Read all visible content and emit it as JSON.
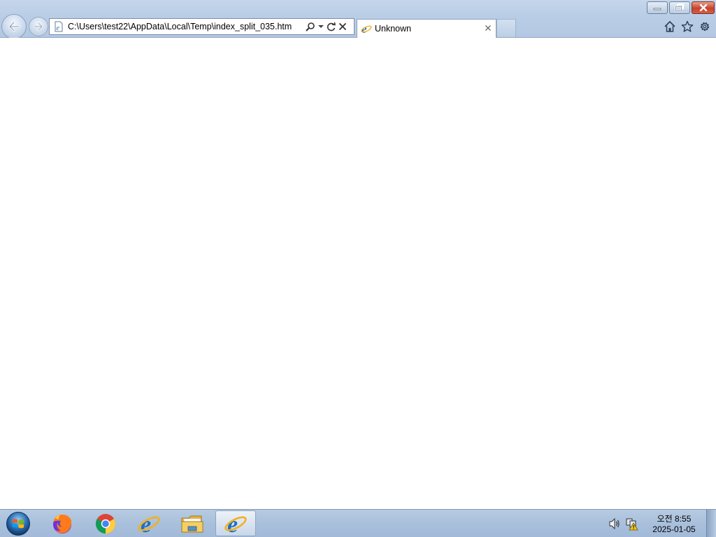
{
  "browser": {
    "address_bar": {
      "url": "C:\\Users\\test22\\AppData\\Local\\Temp\\index_split_035.htm"
    },
    "tabs": [
      {
        "title": "Unknown",
        "active": true
      }
    ],
    "icons": {
      "back": "back-arrow-icon",
      "forward": "forward-arrow-icon",
      "page": "ie-page-icon",
      "search": "search-icon",
      "dropdown": "chevron-down-icon",
      "refresh": "refresh-icon",
      "stop": "stop-icon",
      "home": "home-icon",
      "favorites": "star-icon",
      "tools": "gear-icon"
    }
  },
  "taskbar": {
    "apps": [
      {
        "name": "Firefox",
        "icon": "firefox-icon"
      },
      {
        "name": "Chrome",
        "icon": "chrome-icon"
      },
      {
        "name": "Internet Explorer",
        "icon": "ie-icon"
      },
      {
        "name": "Windows Explorer",
        "icon": "folder-icon"
      },
      {
        "name": "Internet Explorer",
        "icon": "ie-icon",
        "active": true
      }
    ],
    "clock": {
      "time": "오전 8:55",
      "date": "2025-01-05"
    }
  },
  "colors": {
    "frame": "#b9cde6",
    "taskbar": "#a9c0dc",
    "close_button": "#c8412a",
    "ie_blue": "#1f6fc4",
    "ie_ring": "#f2b01e"
  }
}
